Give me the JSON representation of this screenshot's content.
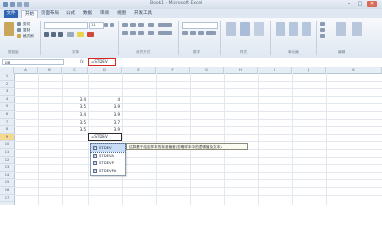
{
  "window": {
    "title": "Book1 - Microsoft Excel",
    "minimize": "–",
    "maximize": "□",
    "close": "✕"
  },
  "menu": {
    "tabs": [
      "文件",
      "开始",
      "页面布局",
      "公式",
      "数据",
      "审阅",
      "视图",
      "开发工具"
    ]
  },
  "ribbon": {
    "clipboard": {
      "cut": "剪切",
      "copy": "复制",
      "format_painter": "格式刷",
      "label": "剪贴板"
    },
    "font": {
      "size_value": "11",
      "label": "字体"
    },
    "alignment": {
      "label": "对齐方式"
    },
    "number": {
      "label": "数字"
    },
    "styles": {
      "label": "样式"
    },
    "cells": {
      "label": "单元格"
    },
    "editing": {
      "label": "编辑"
    }
  },
  "formula_bar": {
    "name_box": "DB",
    "fx": "fx",
    "formula": "=STDEV"
  },
  "grid": {
    "columns": [
      "A",
      "B",
      "C",
      "D",
      "E",
      "F",
      "G",
      "H",
      "I",
      "J",
      "K"
    ],
    "rows": [
      "1",
      "2",
      "3",
      "4",
      "5",
      "6",
      "7",
      "8",
      "9",
      "10",
      "11",
      "12",
      "13",
      "14",
      "15",
      "16",
      "17"
    ],
    "col_c_values": [
      "3.4",
      "3.5",
      "3.4",
      "3.5",
      "3.5"
    ],
    "col_d_values": [
      "4",
      "3.9",
      "3.9",
      "3.7",
      "3.9"
    ],
    "active_cell_text": "=STDEV"
  },
  "autocomplete": {
    "items": [
      "STDEV",
      "STDEVA",
      "STDEVP",
      "STDEVPA"
    ],
    "icon": "fx-function-icon",
    "tooltip": "估算基于给定样本的标准偏差(忽略样本中的逻辑值及文本)"
  },
  "colors": {
    "file_tab": "#2f65b3",
    "highlight_border": "#d8261f",
    "selection": "#c9dcf5"
  }
}
